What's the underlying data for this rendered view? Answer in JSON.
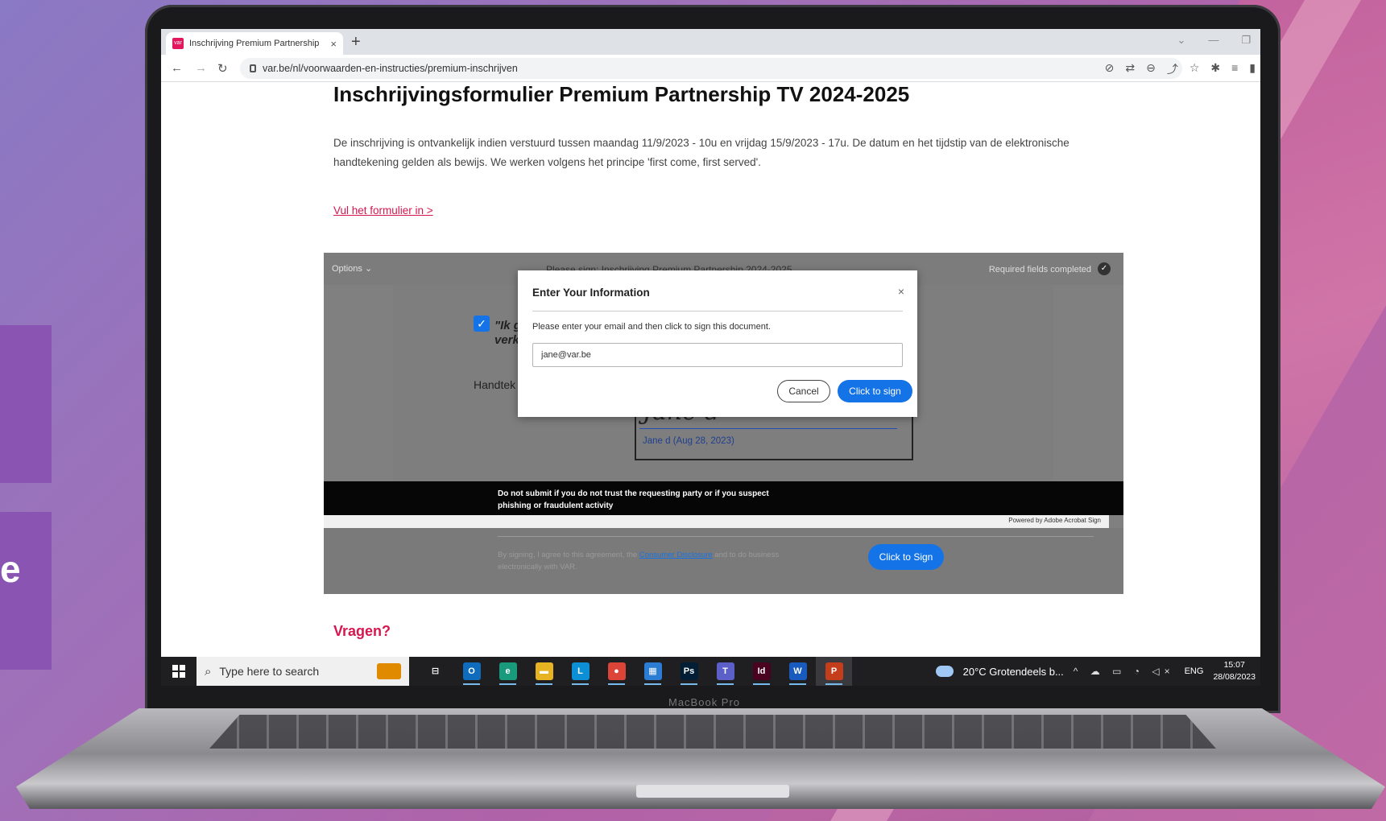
{
  "browser": {
    "tab_title": "Inschrijving Premium Partnership",
    "tab_close": "×",
    "new_tab": "+",
    "url": "var.be/nl/voorwaarden-en-instructies/premium-inschrijven",
    "nav": {
      "back": "←",
      "forward": "→",
      "reload": "↻"
    },
    "toolbar_icons": [
      "⊘",
      "⇄",
      "⊖",
      "⤴",
      "☆",
      "✱",
      "≡",
      "▮"
    ],
    "window_controls": [
      "⌄",
      "—",
      "❐"
    ]
  },
  "page": {
    "title": "Inschrijvingsformulier Premium Partnership TV 2024-2025",
    "intro": "De inschrijving is ontvankelijk indien verstuurd tussen maandag 11/9/2023 - 10u en vrijdag 15/9/2023 - 17u. De datum en het tijdstip van de elektronische handtekening gelden als bewijs. We werken volgens het principe 'first come, first served'.",
    "form_link": "Vul het formulier in >",
    "vragen": "Vragen?"
  },
  "embed": {
    "options": "Options ⌄",
    "please_sign": "Please sign: Inschrijving Premium Partnership 2024-2025",
    "required_completed": "Required fields completed",
    "check": "✓",
    "doc_line1": "\"Ik g",
    "doc_line2": "verk",
    "doc_label": "Handtek",
    "signature_script": "Jane d",
    "signature_name": "Jane d    (Aug 28, 2023)",
    "warning": "Do not submit if you do not trust the requesting party or if you suspect phishing or fraudulent activity",
    "powered_by": "Powered by Adobe Acrobat Sign",
    "consent_before": "By signing, I agree to this agreement, the ",
    "consent_link": "Consumer Disclosure",
    "consent_after": " and to do business electronically with VAR.",
    "sign_button": "Click to Sign"
  },
  "modal": {
    "title": "Enter Your Information",
    "close": "×",
    "message": "Please enter your email and then click to sign this document.",
    "email_value": "jane@var.be",
    "cancel": "Cancel",
    "sign": "Click to sign"
  },
  "taskbar": {
    "search_placeholder": "Type here to search",
    "search_icon": "⌕",
    "apps": [
      {
        "name": "task-view",
        "label": "⊟",
        "color": "#1f1f22"
      },
      {
        "name": "outlook",
        "label": "O",
        "color": "#0f6cbd"
      },
      {
        "name": "edge",
        "label": "e",
        "color": "#1a9a7d"
      },
      {
        "name": "file-explorer",
        "label": "▬",
        "color": "#e8b323"
      },
      {
        "name": "app-l",
        "label": "L",
        "color": "#0d8fd6"
      },
      {
        "name": "chrome",
        "label": "●",
        "color": "#db4437"
      },
      {
        "name": "store",
        "label": "▦",
        "color": "#2b7cd3"
      },
      {
        "name": "photoshop",
        "label": "Ps",
        "color": "#001e36"
      },
      {
        "name": "teams",
        "label": "T",
        "color": "#5b5fc7"
      },
      {
        "name": "indesign",
        "label": "Id",
        "color": "#49021f"
      },
      {
        "name": "word",
        "label": "W",
        "color": "#185abd"
      },
      {
        "name": "powerpoint",
        "label": "P",
        "color": "#c43e1c"
      }
    ],
    "weather": "20°C  Grotendeels b...",
    "tray_icons": "^ ☁ ▭ ◔ ◁×",
    "language": "ENG",
    "time": "15:07",
    "date": "28/08/2023"
  },
  "laptop": {
    "label": "MacBook Pro"
  },
  "background": {
    "side_letter": "e"
  },
  "colors": {
    "accent_pink": "#d6174f",
    "adobe_blue": "#1473e6",
    "taskbar": "#1f1f22"
  }
}
